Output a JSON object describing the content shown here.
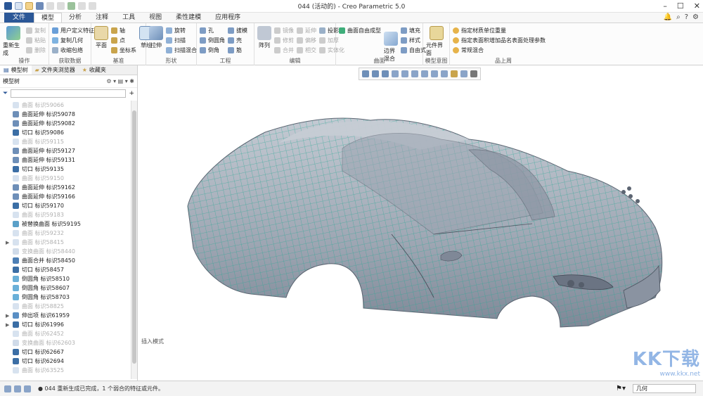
{
  "window": {
    "title": "044 (活动的) - Creo Parametric 5.0"
  },
  "tabs": [
    {
      "label": "文件"
    },
    {
      "label": "模型"
    },
    {
      "label": "分析"
    },
    {
      "label": "注释"
    },
    {
      "label": "工具"
    },
    {
      "label": "视图"
    },
    {
      "label": "柔性建模"
    },
    {
      "label": "应用程序"
    }
  ],
  "ribbon": {
    "operations": {
      "label": "操作",
      "regen": "重新生成",
      "copy": "复制",
      "paste": "粘贴",
      "delete": "删除"
    },
    "get_data": {
      "label": "获取数据",
      "udf": "用户定义特征",
      "copy_geom": "复制几何",
      "shrinkwrap": "收缩包络"
    },
    "datum": {
      "label": "基准",
      "plane": "平面",
      "axis": "轴",
      "point": "点",
      "csys": "坐标系",
      "sketch": "草绘"
    },
    "shapes": {
      "label": "形状",
      "extrude": "拉伸",
      "revolve": "旋转",
      "sweep": "扫描",
      "helical": "扫描混合"
    },
    "engineering": {
      "label": "工程",
      "hole": "孔",
      "round": "倒圆角",
      "chamfer": "倒角",
      "draft": "拔模",
      "shell": "壳",
      "rib": "筋"
    },
    "editing": {
      "label": "编辑",
      "pattern": "阵列",
      "mirror": "镜像",
      "extend": "延伸",
      "project": "投影",
      "trim": "修剪",
      "offset": "偏移",
      "thicken": "加厚",
      "merge": "合并",
      "intersect": "相交",
      "solidify": "实体化"
    },
    "surfaces": {
      "label": "曲面",
      "freestyle": "曲面自由成型",
      "boundary": "边界混合",
      "fill": "填充",
      "style": "样式",
      "freeform": "自由式"
    },
    "model_intent": {
      "label": "模型意图",
      "component": "元件界面"
    },
    "product": {
      "label": "品上周",
      "unit_mass": "指定材质单位重量",
      "param": "指定表面积增加品名表面处理参数",
      "blend": "常规混合"
    }
  },
  "left_panel": {
    "tabs": [
      {
        "label": "模型树"
      },
      {
        "label": "文件夹浏览器"
      },
      {
        "label": "收藏夹"
      }
    ],
    "header": "模型树",
    "items": [
      {
        "label": "曲面 标识59066",
        "dim": true,
        "icon": "surface-icon",
        "exp": ""
      },
      {
        "label": "曲面延伸 标识59078",
        "dim": false,
        "icon": "extend-icon",
        "exp": ""
      },
      {
        "label": "曲面延伸 标识59082",
        "dim": false,
        "icon": "extend-icon",
        "exp": ""
      },
      {
        "label": "切口 标识59086",
        "dim": false,
        "icon": "cut-icon",
        "exp": ""
      },
      {
        "label": "曲面 标识59115",
        "dim": true,
        "icon": "surface-icon",
        "exp": ""
      },
      {
        "label": "曲面延伸 标识59127",
        "dim": false,
        "icon": "extend-icon",
        "exp": ""
      },
      {
        "label": "曲面延伸 标识59131",
        "dim": false,
        "icon": "extend-icon",
        "exp": ""
      },
      {
        "label": "切口 标识59135",
        "dim": false,
        "icon": "cut-icon",
        "exp": ""
      },
      {
        "label": "曲面 标识59150",
        "dim": true,
        "icon": "surface-icon",
        "exp": ""
      },
      {
        "label": "曲面延伸 标识59162",
        "dim": false,
        "icon": "extend-icon",
        "exp": ""
      },
      {
        "label": "曲面延伸 标识59166",
        "dim": false,
        "icon": "extend-icon",
        "exp": ""
      },
      {
        "label": "切口 标识59170",
        "dim": false,
        "icon": "cut-icon",
        "exp": ""
      },
      {
        "label": "曲面 标识59183",
        "dim": true,
        "icon": "surface-icon",
        "exp": ""
      },
      {
        "label": "被替换曲面 标识59195",
        "dim": false,
        "icon": "replace-icon",
        "exp": ""
      },
      {
        "label": "曲面 标识59232",
        "dim": true,
        "icon": "surface-icon",
        "exp": ""
      },
      {
        "label": "曲面 标识58415",
        "dim": true,
        "icon": "surface-icon",
        "exp": "▶"
      },
      {
        "label": "变换曲面 标识58440",
        "dim": true,
        "icon": "transform-icon",
        "exp": ""
      },
      {
        "label": "曲面合并 标识58450",
        "dim": false,
        "icon": "merge-icon",
        "exp": ""
      },
      {
        "label": "切口 标识58457",
        "dim": false,
        "icon": "cut-icon",
        "exp": ""
      },
      {
        "label": "倒圆角 标识58510",
        "dim": false,
        "icon": "round-icon",
        "exp": ""
      },
      {
        "label": "倒圆角 标识58607",
        "dim": false,
        "icon": "round-icon",
        "exp": ""
      },
      {
        "label": "倒圆角 标识58703",
        "dim": false,
        "icon": "round-icon",
        "exp": ""
      },
      {
        "label": "曲面 标识58825",
        "dim": true,
        "icon": "surface-icon",
        "exp": ""
      },
      {
        "label": "伸出项 标识61959",
        "dim": false,
        "icon": "protrusion-icon",
        "exp": "▶"
      },
      {
        "label": "切口 标识61996",
        "dim": false,
        "icon": "cut-icon",
        "exp": "▶"
      },
      {
        "label": "曲面 标识62452",
        "dim": true,
        "icon": "surface-icon",
        "exp": ""
      },
      {
        "label": "变换曲面 标识62603",
        "dim": true,
        "icon": "transform-icon",
        "exp": ""
      },
      {
        "label": "切口 标识62667",
        "dim": false,
        "icon": "cut-icon",
        "exp": ""
      },
      {
        "label": "切口 标识62694",
        "dim": false,
        "icon": "cut-icon",
        "exp": ""
      },
      {
        "label": "曲面 标识63525",
        "dim": true,
        "icon": "surface-icon",
        "exp": ""
      }
    ]
  },
  "graphics": {
    "mode_label": "插入模式"
  },
  "watermark": {
    "text": "KK下载",
    "url": "www.kkx.net"
  },
  "status": {
    "message": "● 044 重新生成已完成，1 个弱合的特征或元件。",
    "filter_value": "几何"
  },
  "colors": {
    "accent": "#2b5797",
    "mesh": "#2aa894",
    "body": "#9ea6b3"
  }
}
